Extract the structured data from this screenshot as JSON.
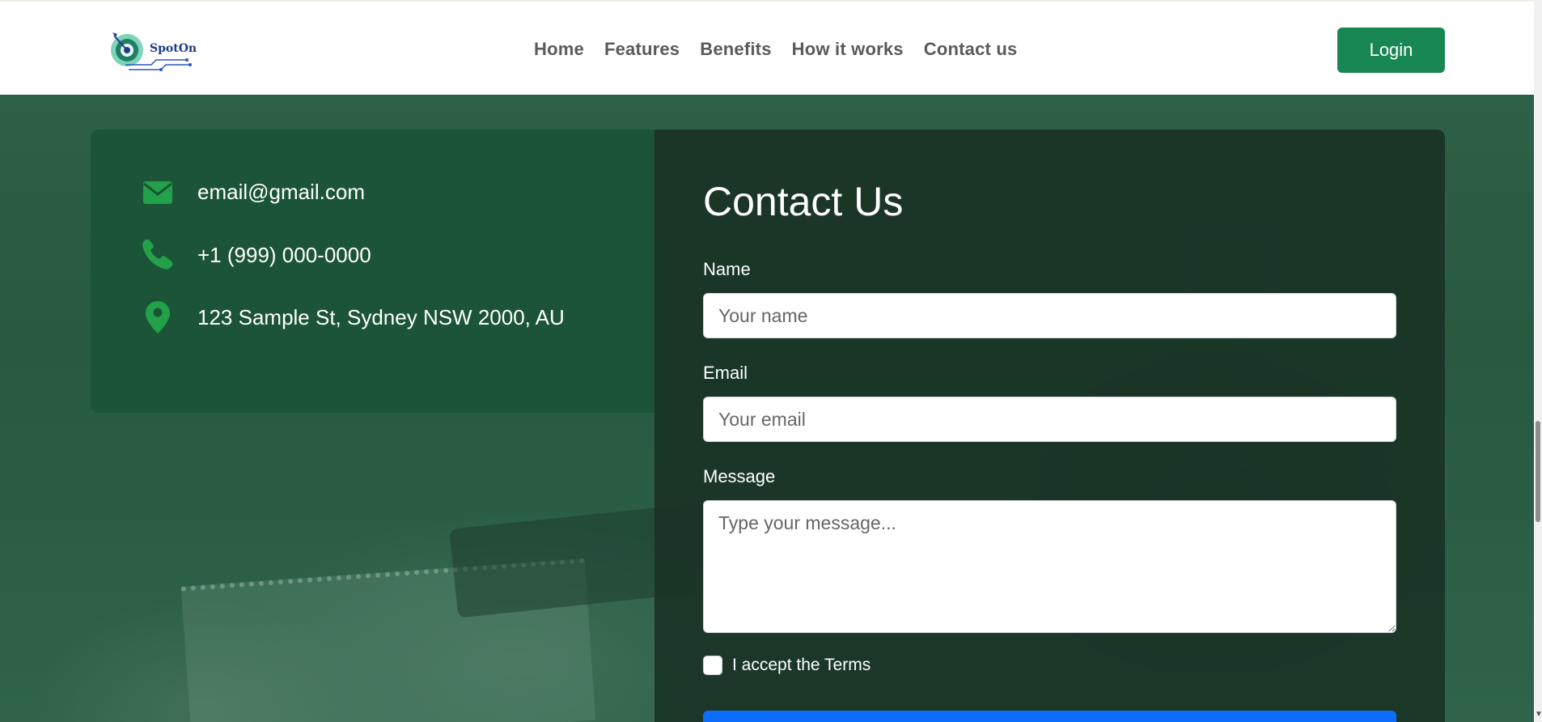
{
  "header": {
    "logo_text": "SpotOn",
    "nav": [
      "Home",
      "Features",
      "Benefits",
      "How it works",
      "Contact us"
    ],
    "login_label": "Login"
  },
  "contact_info": {
    "email": "email@gmail.com",
    "phone": "+1 (999) 000-0000",
    "address": "123 Sample St, Sydney NSW 2000, AU",
    "icons": [
      "envelope-icon",
      "phone-icon",
      "map-pin-icon"
    ]
  },
  "form": {
    "title": "Contact Us",
    "name_label": "Name",
    "name_placeholder": "Your name",
    "email_label": "Email",
    "email_placeholder": "Your email",
    "message_label": "Message",
    "message_placeholder": "Type your message...",
    "terms_label": "I accept the Terms",
    "terms_checked": false
  },
  "colors": {
    "brand_green": "#198754",
    "icon_green": "#22a14a",
    "panel_green": "#1b5436",
    "form_dark": "#183023",
    "submit_blue": "#0d6efd"
  }
}
